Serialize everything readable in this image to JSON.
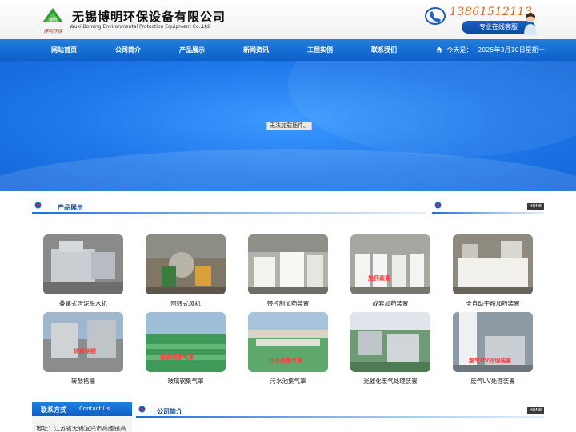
{
  "header": {
    "logo_mark_text": "博明",
    "logo_script_text": "博明环保",
    "company_name_cn": "无锡博明环保设备有限公司",
    "company_name_en": "Wuxi Boming Environmental Protection Equipment Co.,Ltd.",
    "phone": "13861512113",
    "service_label": "专业在线客服"
  },
  "nav": {
    "items": [
      "网站首页",
      "公司简介",
      "产品展示",
      "新闻资讯",
      "工程实例",
      "联系我们"
    ],
    "date_label": "今天是：",
    "date_value": "2025年3月10日星期一"
  },
  "banner": {
    "plugin_message": "无法加载插件。"
  },
  "products_section": {
    "title": "产品展示",
    "home_tag": "HOME"
  },
  "products": [
    {
      "caption": "叠螺式污泥脱水机",
      "overlay": ""
    },
    {
      "caption": "回转式风机",
      "overlay": ""
    },
    {
      "caption": "带控制加药装置",
      "overlay": ""
    },
    {
      "caption": "成套加药装置",
      "overlay": "加药装置"
    },
    {
      "caption": "全自动干粉加药装置",
      "overlay": ""
    },
    {
      "caption": "转鼓格栅",
      "overlay": "转鼓格栅"
    },
    {
      "caption": "玻璃钢集气罩",
      "overlay": "玻璃钢集气罩"
    },
    {
      "caption": "污水池集气罩",
      "overlay": "污水池集气罩"
    },
    {
      "caption": "光催化废气处理装置",
      "overlay": ""
    },
    {
      "caption": "废气UV处理装置",
      "overlay": "废气UV处理装置"
    }
  ],
  "contact": {
    "title_cn": "联系方式",
    "title_en": "Contact Us",
    "address": "地址：江苏省无锡宜兴市高塍镇高"
  },
  "about_section": {
    "title": "公司简介",
    "home_tag": "HOME"
  },
  "colors": {
    "nav_blue": "#0d5fc8",
    "banner_blue": "#1f78ea",
    "phone_orange": "#e8621a",
    "section_title": "#0d4c9e"
  }
}
